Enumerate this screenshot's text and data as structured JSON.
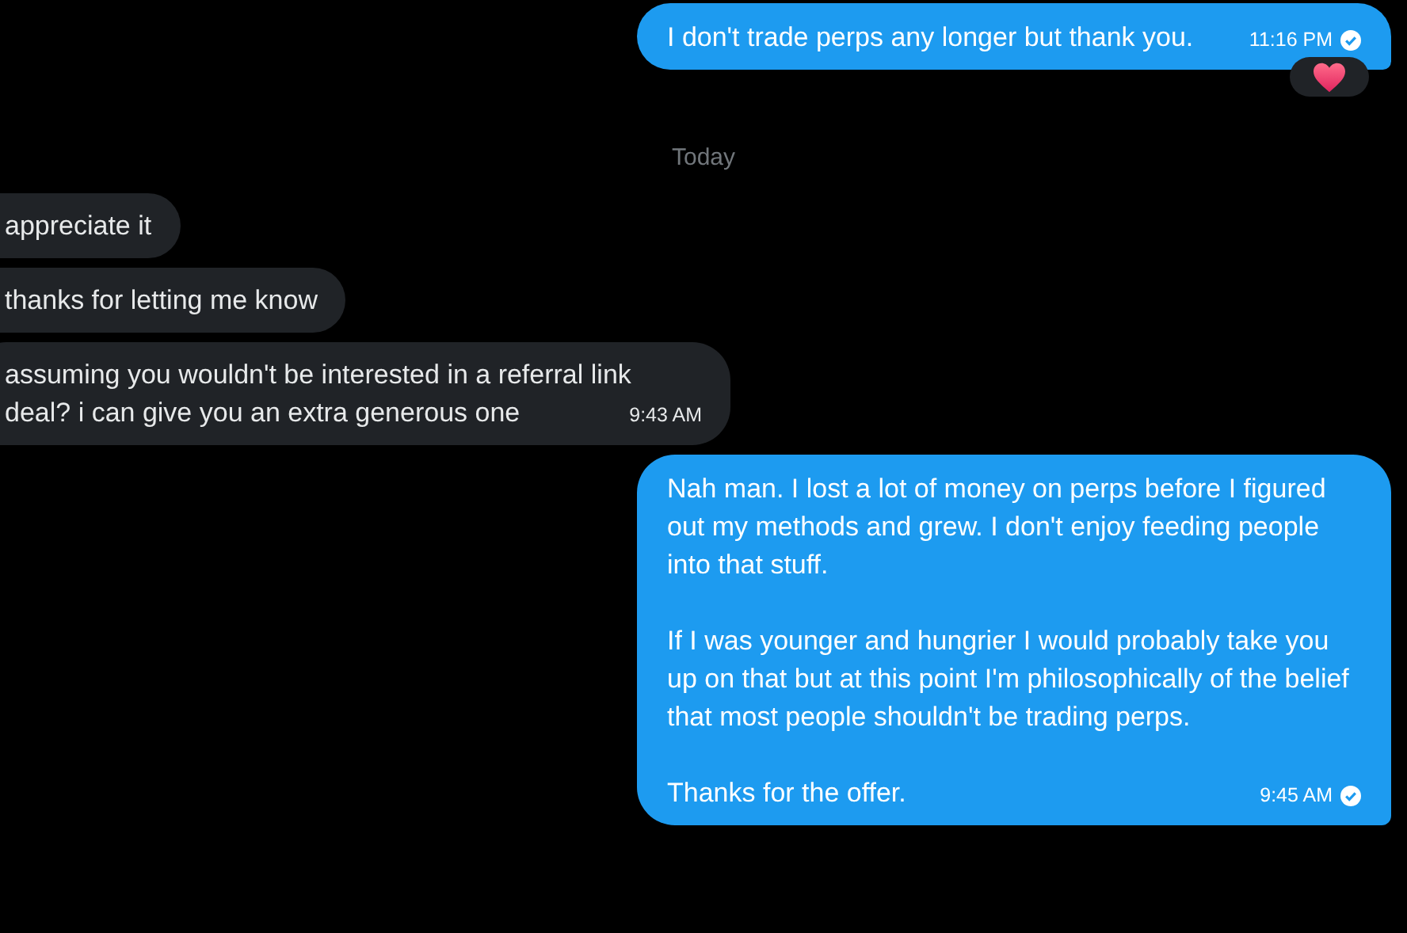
{
  "messages": [
    {
      "kind": "sent",
      "paragraphs": [
        "I don't trade perps any longer but thank you."
      ],
      "time": "11:16 PM",
      "read": true,
      "reaction": true
    },
    {
      "kind": "divider",
      "label": "Today"
    },
    {
      "kind": "received",
      "paragraphs": [
        "appreciate it"
      ]
    },
    {
      "kind": "received",
      "paragraphs": [
        "thanks for letting me know"
      ]
    },
    {
      "kind": "received",
      "paragraphs": [
        "assuming you wouldn't be interested in a referral link deal? i can give you an extra generous one"
      ],
      "time": "9:43 AM"
    },
    {
      "kind": "sent",
      "paragraphs": [
        "Nah man. I lost a lot of money on perps before I figured out my methods and grew. I don't enjoy feeding people into that stuff.",
        "If I was younger and hungrier I would probably take you up on that but at this point I'm philosophically of the belief that most people shouldn't be trading perps.",
        "Thanks for the offer."
      ],
      "time": "9:45 AM",
      "read": true,
      "reaction": false
    }
  ]
}
